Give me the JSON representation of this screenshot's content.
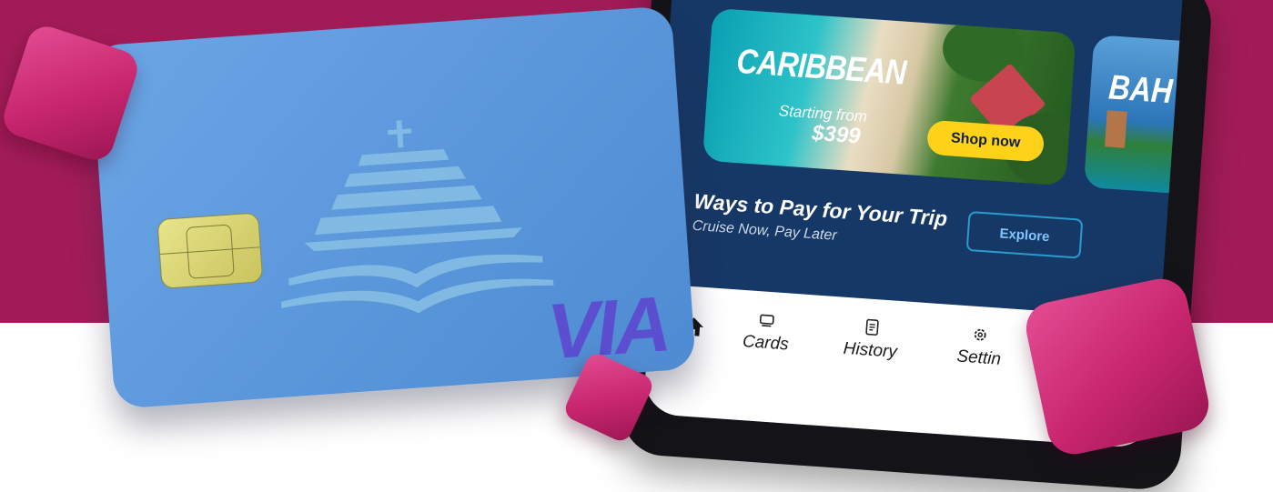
{
  "promo": {
    "title": "CARIBBEAN",
    "starting_from": "Starting from",
    "price": "$399",
    "shop_label": "Shop now",
    "next_title": "BAH"
  },
  "section": {
    "title": "Ways to Pay for Your Trip",
    "subtitle": "Cruise Now, Pay Later",
    "explore_label": "Explore"
  },
  "nav": {
    "home_icon": "home-icon",
    "items": [
      {
        "label": "Cards",
        "icon": "cards-icon"
      },
      {
        "label": "History",
        "icon": "history-icon"
      },
      {
        "label": "Settin",
        "icon": "gear-icon"
      }
    ]
  },
  "card": {
    "logo": "VIA"
  },
  "colors": {
    "band": "#a31c58",
    "screen": "#163866",
    "card": "#5a96da",
    "shop_button": "#ffd21a",
    "cube": "#c8266f",
    "logo": "#5b4fcf"
  }
}
